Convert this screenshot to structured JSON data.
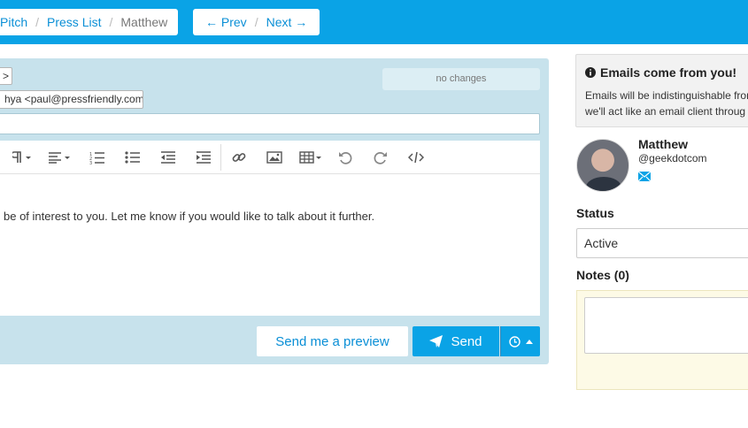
{
  "breadcrumb": {
    "items": [
      "Pitch",
      "Press List"
    ],
    "current": "Matthew",
    "separator": "/"
  },
  "pager": {
    "prev": "← Prev",
    "next": "Next →",
    "separator": "/"
  },
  "composer": {
    "to_fragment": ">",
    "from_value": "hya <paul@pressfriendly.com>",
    "status_text": "no changes",
    "body_text": "be of interest to you. Let me know if you would like to talk about it further.",
    "toolbar_icons": [
      "paragraph-icon",
      "align-icon",
      "ordered-list-icon",
      "unordered-list-icon",
      "outdent-icon",
      "indent-icon",
      "link-icon",
      "image-icon",
      "table-icon",
      "undo-icon",
      "redo-icon",
      "code-view-icon"
    ],
    "preview_label": "Send me a preview",
    "send_label": "Send"
  },
  "notice": {
    "title": "Emails come from you!",
    "line1": "Emails will be indistinguishable fron",
    "line2": "we'll act like an email client throug"
  },
  "contact": {
    "name": "Matthew",
    "handle": "@geekdotcom"
  },
  "status": {
    "label": "Status",
    "value": "Active"
  },
  "notes": {
    "label": "Notes (0)"
  },
  "colors": {
    "brand": "#0aa3e6",
    "link": "#0a8fd6",
    "composer_bg": "#c7e2ec",
    "notes_bg": "#fdfae6"
  }
}
